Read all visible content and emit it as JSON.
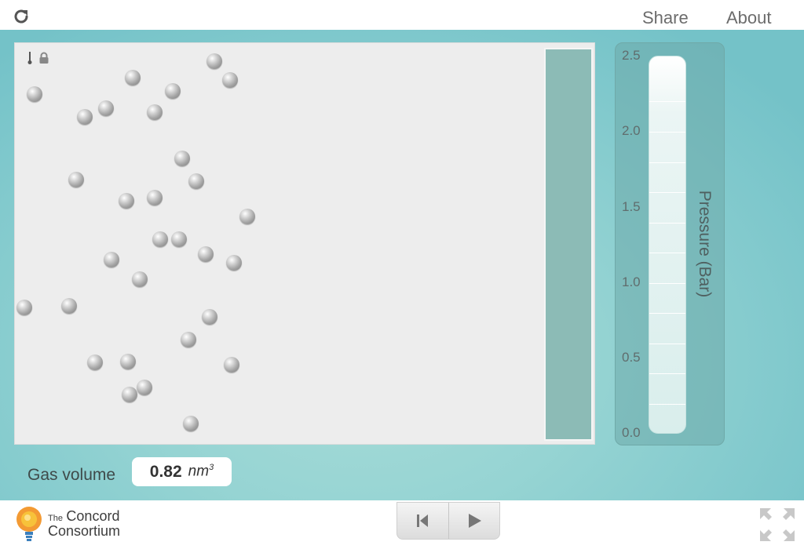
{
  "header": {
    "share_label": "Share",
    "about_label": "About",
    "reload_icon": "reload-icon"
  },
  "model": {
    "toolbar_icons": [
      "thermometer-icon",
      "lock-icon"
    ],
    "particle_count": 33
  },
  "gauge": {
    "title": "Pressure (Bar)",
    "ticks": [
      "2.5",
      "2.0",
      "1.5",
      "1.0",
      "0.5",
      "0.0"
    ],
    "max": 2.5,
    "min": 0.0,
    "value_fraction": 0.0
  },
  "gas_volume": {
    "label": "Gas volume",
    "value": "0.82",
    "unit": "nm",
    "unit_exp": "3"
  },
  "footer": {
    "logo_line1_small": "The",
    "logo_line1_big": "Concord",
    "logo_line2": "Consortium",
    "controls": [
      "reset-icon",
      "play-icon"
    ]
  },
  "colors": {
    "background_teal": "#7fc8cc",
    "piston": "#8cbbb6",
    "model_area": "#ededed"
  }
}
